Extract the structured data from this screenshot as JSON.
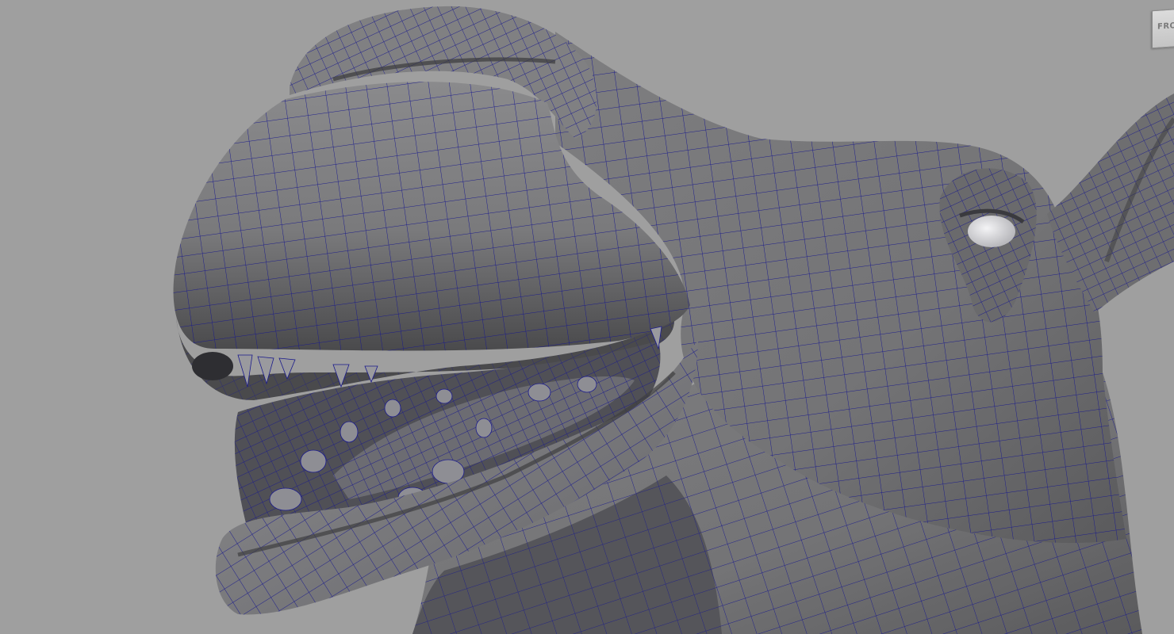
{
  "viewport": {
    "background_color": "#a0a0a0",
    "mesh_fill_color": "#7c7c7e",
    "mesh_shadow_color": "#3c3c3e",
    "mesh_highlight_color": "#b4b4b6",
    "wireframe_color": "#1a1a8c",
    "shading_mode": "wireframe-on-shaded"
  },
  "view_cube": {
    "face_label": "FRONT"
  }
}
